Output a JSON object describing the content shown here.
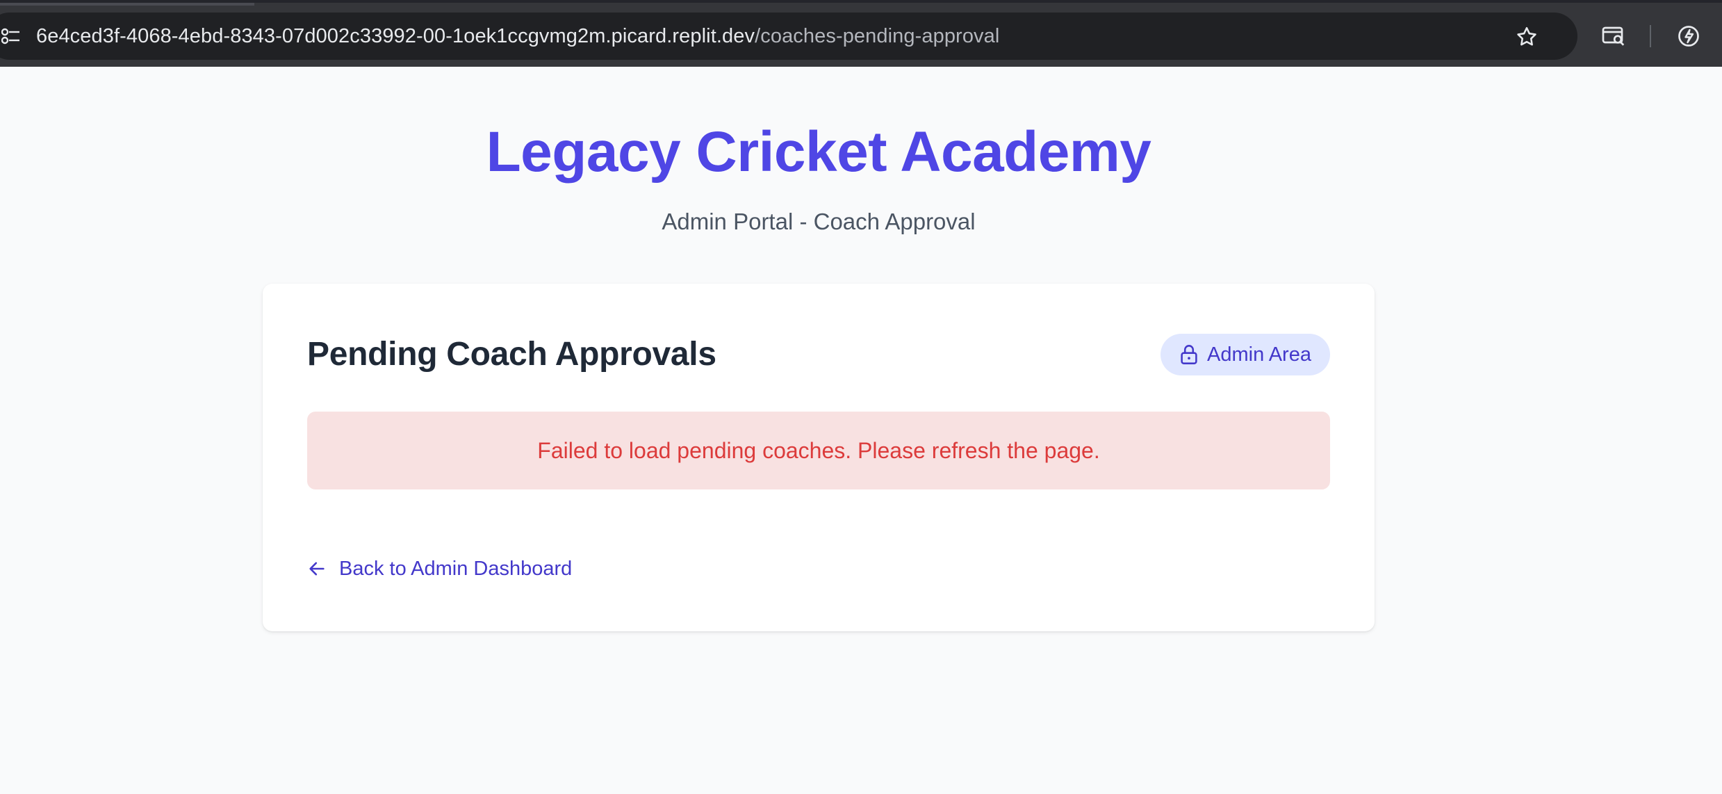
{
  "browser": {
    "url_host": "6e4ced3f-4068-4ebd-8343-07d002c33992-00-1oek1ccgvmg2m.picard.replit.dev",
    "url_path": "/coaches-pending-approval",
    "icons": [
      "site-info-icon",
      "bookmark-star-icon",
      "search-tabs-icon",
      "extension-icon"
    ]
  },
  "header": {
    "title": "Legacy Cricket Academy",
    "subtitle": "Admin Portal - Coach Approval"
  },
  "card": {
    "title": "Pending Coach Approvals",
    "badge_label": "Admin Area",
    "badge_icon": "lock-icon",
    "error_message": "Failed to load pending coaches. Please refresh the page.",
    "back_link_label": "Back to Admin Dashboard",
    "back_link_icon": "arrow-left-icon"
  },
  "colors": {
    "brand": "#4f46e5",
    "error_text": "#dc3b3b",
    "error_bg": "#f8e1e1",
    "badge_bg": "#e0e7ff"
  }
}
